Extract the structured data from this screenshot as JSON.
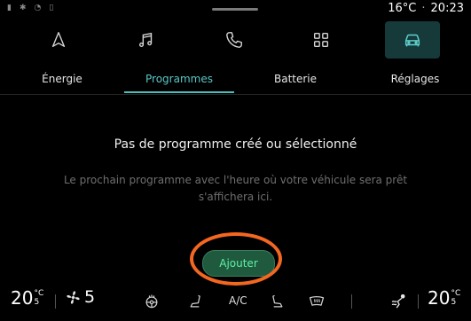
{
  "status": {
    "temperature": "16°C",
    "separator": "·",
    "time": "20:23",
    "icons": [
      "signal-icon",
      "bluetooth-icon",
      "wifi-icon",
      "phone-icon"
    ]
  },
  "nav": {
    "items": [
      {
        "name": "navigation-icon"
      },
      {
        "name": "music-icon"
      },
      {
        "name": "phone-icon"
      },
      {
        "name": "apps-icon"
      },
      {
        "name": "vehicle-icon",
        "active": true
      }
    ]
  },
  "tabs": [
    "Énergie",
    "Programmes",
    "Batterie",
    "Réglages"
  ],
  "active_tab": "Programmes",
  "message": {
    "title": "Pas de programme créé ou sélectionné",
    "description": "Le prochain programme avec l'heure où votre véhicule sera prêt s'affichera ici."
  },
  "add_button": {
    "label": "Ajouter"
  },
  "climate": {
    "left_temp": "20",
    "left_temp_frac": "5",
    "left_temp_unit": "°C",
    "fan_level": "5",
    "ac_label": "A/C",
    "right_temp": "20",
    "right_temp_frac": "5",
    "right_temp_unit": "°C"
  },
  "colors": {
    "accent": "#4dbcbb",
    "button_bg": "#1f5a3f",
    "button_text": "#5ff0a8",
    "highlight_ring": "#f36721"
  }
}
